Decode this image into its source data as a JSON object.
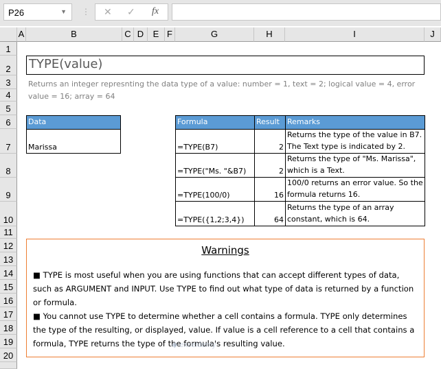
{
  "toolbar": {
    "name_box": "P26",
    "cancel_icon": "✕",
    "enter_icon": "✓",
    "fx_label": "fx",
    "formula": ""
  },
  "columns": [
    "A",
    "B",
    "C",
    "D",
    "E",
    "F",
    "G",
    "H",
    "I",
    "J"
  ],
  "rows": [
    "1",
    "2",
    "3",
    "4",
    "5",
    "6",
    "7",
    "8",
    "9",
    "10",
    "11",
    "12",
    "13",
    "14",
    "15",
    "16",
    "17",
    "18",
    "19",
    "20"
  ],
  "title": "TYPE(value)",
  "description": "Returns an integer represnting the data type of a value: number = 1, text = 2; logical value = 4, error value = 16; array = 64",
  "data_table": {
    "header": "Data",
    "value": "Marissa"
  },
  "formula_table": {
    "headers": [
      "Formula",
      "Result",
      "Remarks"
    ],
    "rows": [
      {
        "formula": "=TYPE(B7)",
        "result": "2",
        "remark": "Returns the type of the value in B7. The Text type is indicated by 2."
      },
      {
        "formula": "=TYPE(\"Ms. \"&B7)",
        "result": "2",
        "remark": "Returns the type of \"Ms. Marissa\", which is a Text."
      },
      {
        "formula": "=TYPE(100/0)",
        "result": "16",
        "remark": "100/0 returns an error value. So the formula returns 16."
      },
      {
        "formula": "=TYPE({1,2;3,4})",
        "result": "64",
        "remark": "Returns the type of an array constant, which is 64."
      }
    ]
  },
  "warnings": {
    "title": "Warnings",
    "items": [
      "■ TYPE is most useful when you are using functions that can accept different types of data, such as ARGUMENT and INPUT. Use TYPE to find out what type of data is returned by a function or formula.",
      "■ You cannot use TYPE to determine whether a cell contains a formula. TYPE only determines the type of the resulting, or displayed, value. If value is a cell reference to a cell that contains a formula, TYPE returns the type of the formula's resulting value."
    ]
  },
  "watermark": "exceldemy EXCEL · DATA · BI",
  "colors": {
    "header_blue": "#5b9bd5",
    "warning_border": "#ed7d31",
    "desc_text": "#7f7f7f"
  }
}
